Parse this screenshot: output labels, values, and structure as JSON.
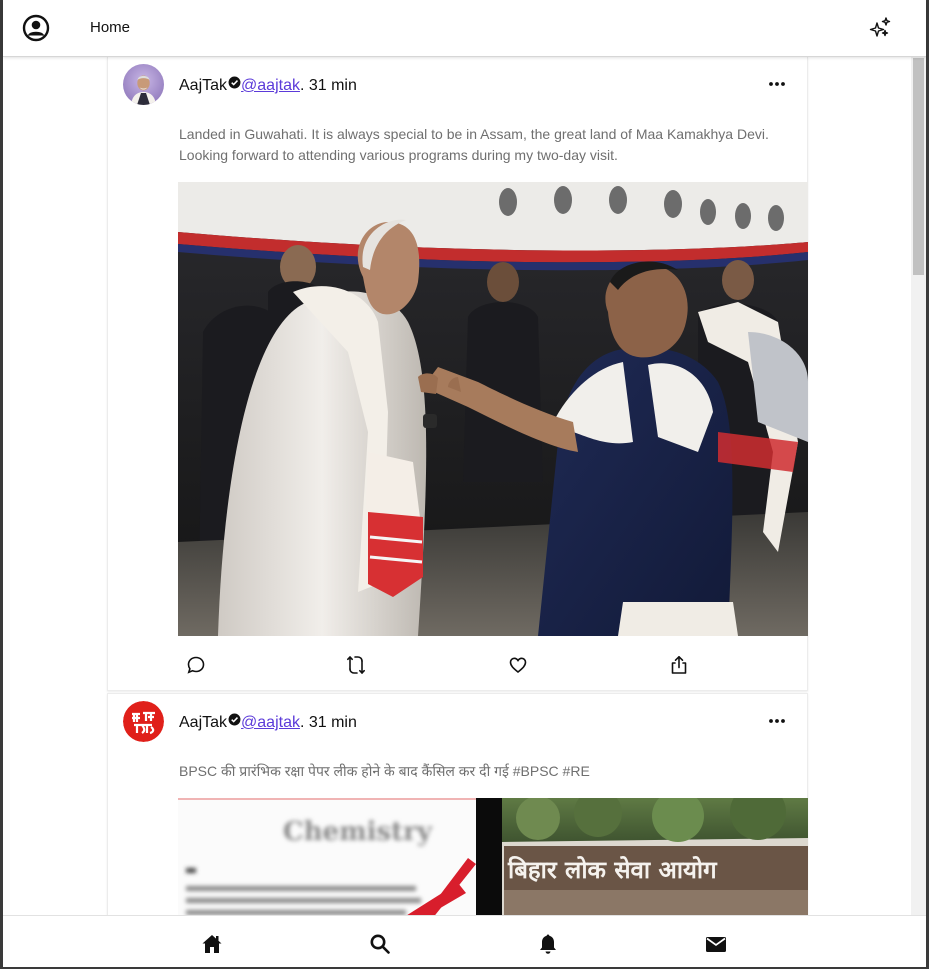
{
  "header": {
    "title": "Home",
    "profile_icon": "user-circle-icon",
    "sparkle_icon": "sparkles-icon"
  },
  "tweets": [
    {
      "name": "AajTak",
      "handle": "@aajtak",
      "time": ". 31 min",
      "text": "Landed in Guwahati. It is always special to be in Assam, the great land of Maa Kamakhya Devi. Looking forward to attending various programs during my two-day visit.",
      "avatar": "politician-portrait-avatar",
      "media": "photo-greeting-with-gamosa-scarf",
      "actions": [
        "comment-icon",
        "retweet-icon",
        "like-icon",
        "share-icon"
      ]
    },
    {
      "name": "AajTak",
      "handle": "@aajtak",
      "time": ". 31 min",
      "text": "BPSC की प्रारंभिक रक्षा पेपर लीक होने के बाद कैंसिल कर दी गई #BPSC #RE",
      "avatar": "aajtak-logo-avatar",
      "media_banner_text": "बिहार लोक सेवा आयोग",
      "media_blurred_heading": "Chemistry"
    }
  ],
  "bottom_nav": [
    "home-icon",
    "search-icon",
    "bell-icon",
    "mail-icon"
  ],
  "colors": {
    "handle": "#5b3ad9",
    "text_muted": "#6f6f6f",
    "aajtak_red": "#e0201a"
  }
}
